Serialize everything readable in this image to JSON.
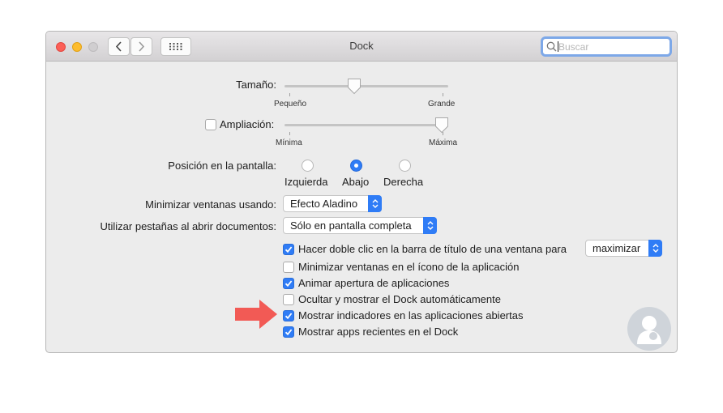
{
  "window": {
    "title": "Dock",
    "search_placeholder": "Buscar"
  },
  "size": {
    "label": "Tamaño:",
    "min_label": "Pequeño",
    "max_label": "Grande",
    "value_fraction": 0.43
  },
  "magnification": {
    "label": "Ampliación:",
    "enabled": false,
    "min_label": "Mínima",
    "max_label": "Máxima",
    "value_fraction": 0.97
  },
  "position": {
    "label": "Posición en la pantalla:",
    "options": [
      "Izquierda",
      "Abajo",
      "Derecha"
    ],
    "selected": "Abajo"
  },
  "minimize": {
    "label": "Minimizar ventanas usando:",
    "value": "Efecto Aladino"
  },
  "tabs": {
    "label": "Utilizar pestañas al abrir documentos:",
    "value": "Sólo en pantalla completa"
  },
  "options": [
    {
      "label": "Hacer doble clic en la barra de título de una ventana para",
      "checked": true
    },
    {
      "label": "Minimizar ventanas en el ícono de la aplicación",
      "checked": false
    },
    {
      "label": "Animar apertura de aplicaciones",
      "checked": true
    },
    {
      "label": "Ocultar y mostrar el Dock automáticamente",
      "checked": false
    },
    {
      "label": "Mostrar indicadores en las aplicaciones abiertas",
      "checked": true
    },
    {
      "label": "Mostrar apps recientes en el Dock",
      "checked": true
    }
  ],
  "double_click_action": {
    "value": "maximizar"
  },
  "colors": {
    "accent": "#2f7cf6",
    "annotation_arrow": "#f25a55",
    "logo": "#cfd4da"
  },
  "icons": [
    "back-icon",
    "forward-icon",
    "grid-icon",
    "search-icon",
    "arrow-annotation-icon",
    "watermark-logo-icon"
  ]
}
